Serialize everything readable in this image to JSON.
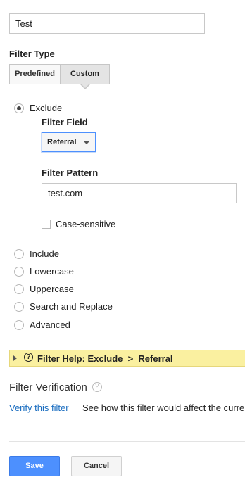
{
  "filter_name": {
    "value": "Test"
  },
  "filter_type": {
    "label": "Filter Type",
    "tabs": [
      {
        "label": "Predefined",
        "selected": false
      },
      {
        "label": "Custom",
        "selected": true
      }
    ]
  },
  "options": {
    "exclude": {
      "label": "Exclude",
      "checked": true
    },
    "include": {
      "label": "Include",
      "checked": false
    },
    "lowercase": {
      "label": "Lowercase",
      "checked": false
    },
    "uppercase": {
      "label": "Uppercase",
      "checked": false
    },
    "search_replace": {
      "label": "Search and Replace",
      "checked": false
    },
    "advanced": {
      "label": "Advanced",
      "checked": false
    }
  },
  "filter_field": {
    "label": "Filter Field",
    "selected": "Referral"
  },
  "filter_pattern": {
    "label": "Filter Pattern",
    "value": "test.com"
  },
  "case_sensitive": {
    "label": "Case-sensitive",
    "checked": false
  },
  "filter_help": {
    "text": "Filter Help: Exclude  >  Referral",
    "icon": "question-circle-icon"
  },
  "verification": {
    "title": "Filter Verification",
    "link": "Verify this filter",
    "description": "See how this filter would affect the curre"
  },
  "actions": {
    "save": "Save",
    "cancel": "Cancel"
  },
  "colors": {
    "primary": "#4d90fe",
    "link": "#1a6dc0",
    "help_bg": "#faf0a0"
  }
}
